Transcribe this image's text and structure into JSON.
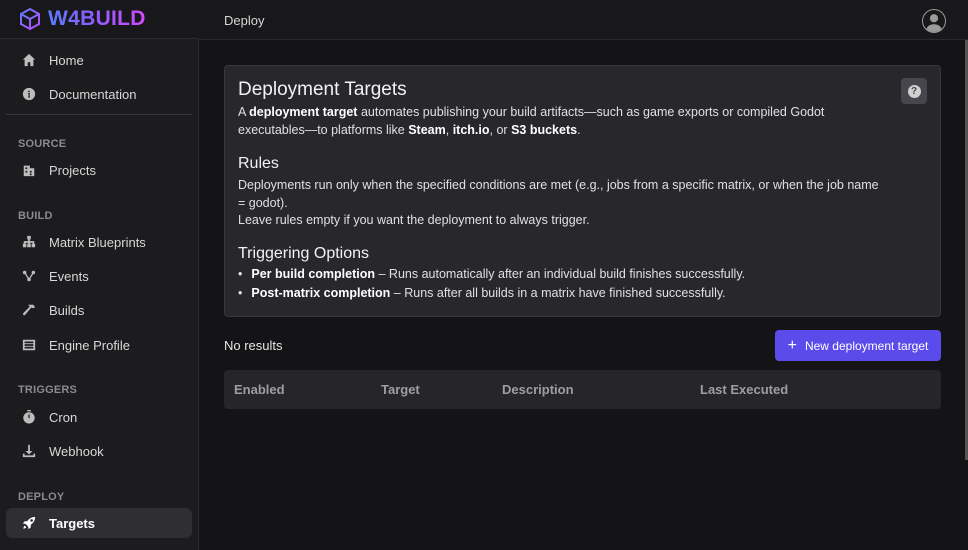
{
  "brand": {
    "name": "W4BUILD"
  },
  "header": {
    "title": "Deploy"
  },
  "sidebar": {
    "home": "Home",
    "documentation": "Documentation",
    "sections": {
      "source": "SOURCE",
      "build": "BUILD",
      "triggers": "TRIGGERS",
      "deploy": "DEPLOY"
    },
    "items": {
      "projects": "Projects",
      "matrix_blueprints": "Matrix Blueprints",
      "events": "Events",
      "builds": "Builds",
      "engine_profile": "Engine Profile",
      "cron": "Cron",
      "webhook": "Webhook",
      "targets": "Targets"
    },
    "active": "targets"
  },
  "card": {
    "title": "Deployment Targets",
    "intro": {
      "t1": "A ",
      "b1": "deployment target",
      "t2": " automates publishing your build artifacts—such as game exports or compiled Godot executables—to platforms like ",
      "b2": "Steam",
      "t3": ", ",
      "b3": "itch.io",
      "t4": ", or ",
      "b4": "S3 buckets",
      "t5": "."
    },
    "rules_title": "Rules",
    "rules_text_1": "Deployments run only when the specified conditions are met (e.g., jobs from a specific matrix, or when the job name = godot).",
    "rules_text_2": "Leave rules empty if you want the deployment to always trigger.",
    "options_title": "Triggering Options",
    "options": [
      {
        "name": "Per build completion",
        "desc": " – Runs automatically after an individual build finishes successfully."
      },
      {
        "name": "Post-matrix completion",
        "desc": " – Runs after all builds in a matrix have finished successfully."
      }
    ]
  },
  "results": {
    "empty_text": "No results",
    "new_button": "New deployment target"
  },
  "table": {
    "columns": [
      "Enabled",
      "Target",
      "Description",
      "Last Executed"
    ]
  }
}
